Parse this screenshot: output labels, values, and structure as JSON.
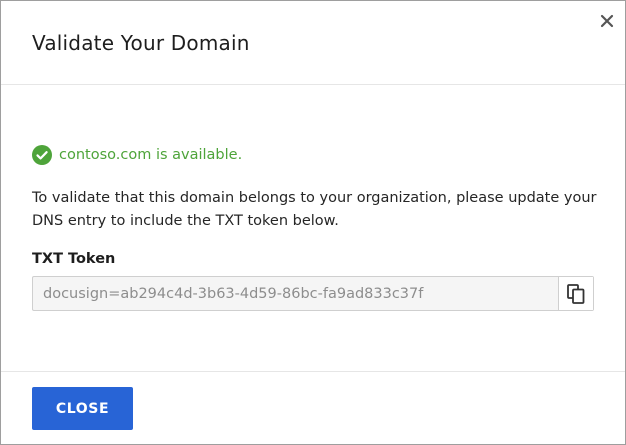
{
  "dialog": {
    "title": "Validate Your Domain",
    "close_icon": "close-icon"
  },
  "status": {
    "icon": "check-circle-icon",
    "text": "contoso.com is available.",
    "color": "#4ea43a"
  },
  "description": "To validate that this domain belongs to your organization, please update your DNS entry to include the TXT token below.",
  "token": {
    "label": "TXT Token",
    "value": "docusign=ab294c4d-3b63-4d59-86bc-fa9ad833c37f",
    "copy_icon": "copy-icon"
  },
  "footer": {
    "close_label": "CLOSE",
    "accent": "#2864d6"
  }
}
